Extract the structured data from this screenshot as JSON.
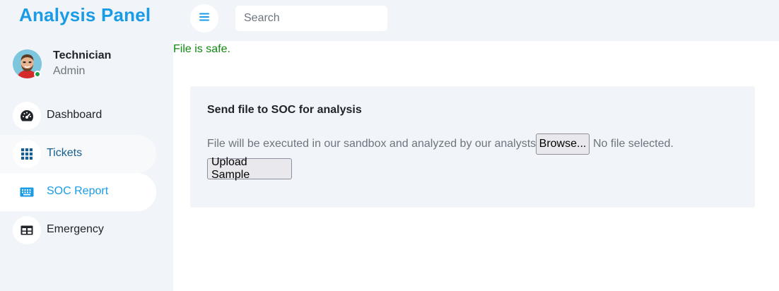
{
  "app": {
    "title": "Analysis Panel"
  },
  "profile": {
    "name": "Technician",
    "role": "Admin"
  },
  "sidebar": {
    "items": [
      {
        "label": "Dashboard",
        "icon": "speedometer-icon",
        "state": "normal"
      },
      {
        "label": "Tickets",
        "icon": "grid-icon",
        "state": "hover"
      },
      {
        "label": "SOC Report",
        "icon": "keyboard-icon",
        "state": "active"
      },
      {
        "label": "Emergency",
        "icon": "table-icon",
        "state": "normal"
      }
    ]
  },
  "topbar": {
    "menu_icon": "hamburger-icon",
    "search_placeholder": "Search"
  },
  "main": {
    "status_message": "File is safe.",
    "card": {
      "title": "Send file to SOC for analysis",
      "description": "File will be executed in our sandbox and analyzed by our analysts",
      "browse_label": "Browse...",
      "no_file_label": "No file selected.",
      "upload_label": "Upload Sample"
    }
  },
  "colors": {
    "brand": "#1a9be6",
    "sidebar_bg": "#f1f4f8",
    "success": "#118a11",
    "online_dot": "#1e9e4a",
    "hover_label": "#175e8e"
  }
}
